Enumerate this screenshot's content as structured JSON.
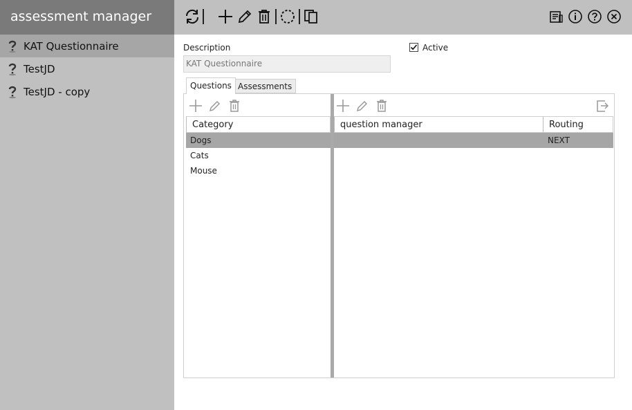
{
  "app": {
    "title": "assessment manager"
  },
  "sidebar": {
    "items": [
      {
        "label": "KAT Questionnaire",
        "icon": "question-mark-icon",
        "selected": true
      },
      {
        "label": "TestJD",
        "icon": "question-mark-icon",
        "selected": false
      },
      {
        "label": "TestJD - copy",
        "icon": "question-mark-icon",
        "selected": false
      }
    ]
  },
  "toolbar": {
    "left_icons": [
      "refresh-icon",
      "add-icon",
      "edit-icon",
      "delete-icon",
      "circle-dashed-icon",
      "copy-icon"
    ],
    "right_icons": [
      "report-icon",
      "info-icon",
      "help-icon",
      "close-icon"
    ]
  },
  "form": {
    "description_label": "Description",
    "description_value": "KAT Questionnaire",
    "active_label": "Active",
    "active_checked": true
  },
  "tabs": [
    {
      "label": "Questions",
      "active": true
    },
    {
      "label": "Assessments",
      "active": false
    }
  ],
  "category_grid": {
    "header": "Category",
    "rows": [
      "Dogs",
      "Cats",
      "Mouse"
    ],
    "selected_index": 0
  },
  "question_grid": {
    "headers": [
      "question manager",
      "Routing"
    ],
    "rows": [
      {
        "question": "",
        "routing": "NEXT"
      }
    ],
    "selected_index": 0
  },
  "colors": {
    "sidebar_bg": "#c0c0c0",
    "header_bg": "#7a7a7a",
    "selected_bg": "#a6a6a6"
  }
}
